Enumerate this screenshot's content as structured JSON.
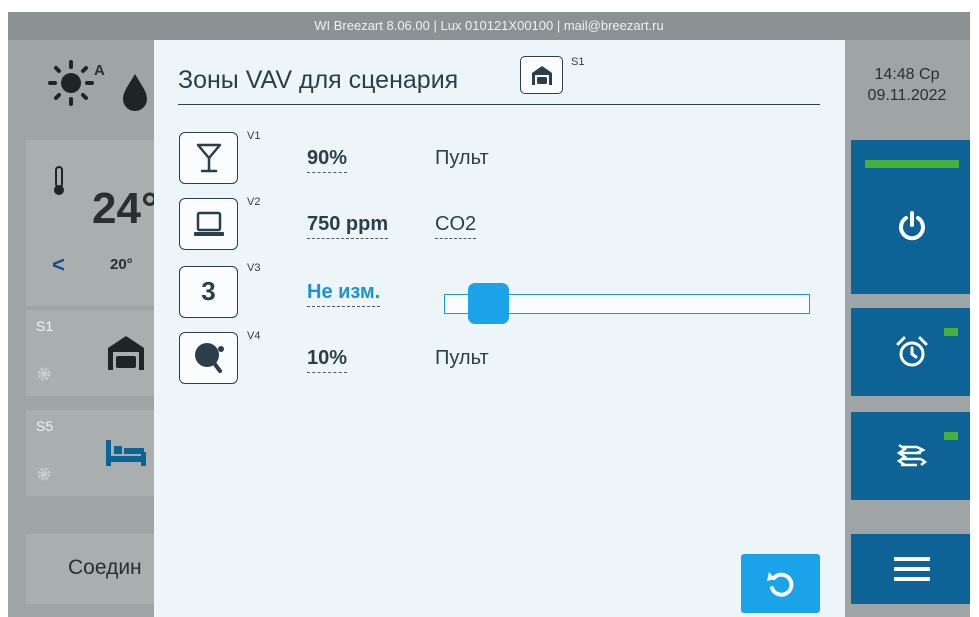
{
  "topbar": {
    "text": "WI Breezart 8.06.00 | Lux 010121X00100 | mail@breezart.ru"
  },
  "weather": {
    "mode_letter": "A",
    "icons": [
      "sun-icon",
      "drop-icon"
    ]
  },
  "clock": {
    "time": "14:48 Ср",
    "date": "09.11.2022"
  },
  "temperature": {
    "current": "24°",
    "setpoint": "20°"
  },
  "scenarios": [
    {
      "label": "S1",
      "icon": "garage-icon"
    },
    {
      "label": "S5",
      "icon": "bed-icon"
    }
  ],
  "connection": {
    "label": "Соедин"
  },
  "right_buttons": [
    "power-icon",
    "alarm-clock-icon",
    "airflow-icon",
    "menu-icon"
  ],
  "modal": {
    "title": "Зоны VAV для сценария",
    "scenario_badge": "S1",
    "zones": [
      {
        "id": "V1",
        "icon": "cocktail-glass-icon",
        "value": "90%",
        "source": "Пульт"
      },
      {
        "id": "V2",
        "icon": "laptop-icon",
        "value": "750 ppm",
        "source": "CO2"
      },
      {
        "id": "V3",
        "icon_text": "3",
        "value": "Не изм.",
        "slider_fraction": 0.07
      },
      {
        "id": "V4",
        "icon": "ping-pong-icon",
        "value": "10%",
        "source": "Пульт"
      }
    ],
    "reset_icon": "reset-icon"
  },
  "colors": {
    "accent": "#1aa3e8",
    "dark_button": "#0d6396",
    "indicator": "#49b03a"
  }
}
